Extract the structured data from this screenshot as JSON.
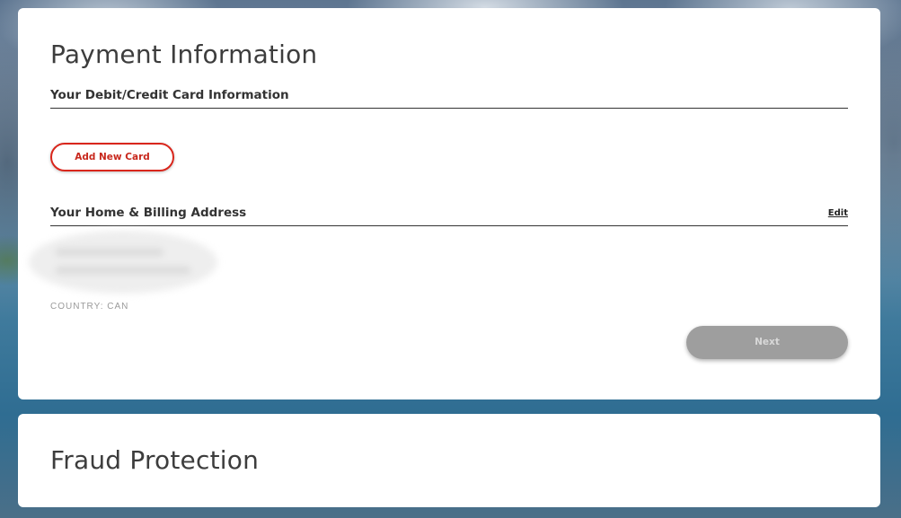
{
  "payment": {
    "title": "Payment Information",
    "card_section_label": "Your Debit/Credit Card Information",
    "add_card_label": "Add New Card",
    "address_section_label": "Your Home & Billing Address",
    "edit_label": "Edit",
    "country_line": "COUNTRY: CAN",
    "next_label": "Next",
    "next_disabled": true
  },
  "fraud": {
    "title": "Fraud Protection"
  },
  "colors": {
    "accent_red": "#d9261c",
    "disabled_button": "#9e9e9e"
  }
}
